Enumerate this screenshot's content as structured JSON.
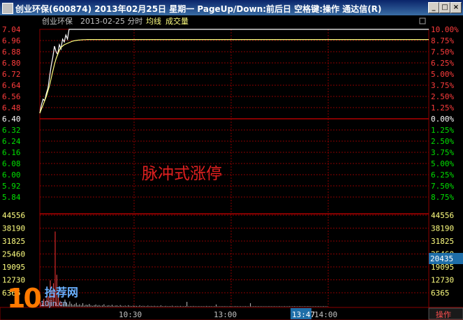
{
  "window": {
    "title": "创业环保(600874) 2013年02月25日 星期一 PageUp/Down:前后日 空格键:操作 通达信(R)",
    "buttons": [
      "_",
      "□",
      "×"
    ]
  },
  "chart_header": {
    "stock_name": "创业环保",
    "date_label": "2013-02-25 分时",
    "avg_line_label": "均线",
    "volume_label": "成交量"
  },
  "annotation": "脉冲式涨停",
  "volume_badge": "20435",
  "bottom_bar": {
    "time_labels": [
      "10:30",
      "13:00",
      "14:00"
    ],
    "cursor_time": "13:47",
    "action_label": "操作"
  },
  "watermark": {
    "number": "10",
    "name": "抬荐网",
    "url": "10jin.cn"
  },
  "colors": {
    "up": "#ff3c3c",
    "flat": "#ffffff",
    "down": "#00e000",
    "grid": "#8b0000",
    "price_line": "#ffffff",
    "avg_line": "#ffff80",
    "volume": "#ffff40"
  },
  "chart_data": [
    {
      "type": "line",
      "name": "price",
      "y_axis_left": [
        "7.04",
        "6.96",
        "6.88",
        "6.80",
        "6.72",
        "6.64",
        "6.56",
        "6.48",
        "6.40",
        "6.32",
        "6.24",
        "6.16",
        "6.08",
        "6.00",
        "5.92",
        "5.84"
      ],
      "y_axis_right": [
        "10.00%",
        "8.75%",
        "7.50%",
        "6.25%",
        "5.00%",
        "3.75%",
        "2.50%",
        "1.25%",
        "0.00%",
        "1.25%",
        "2.50%",
        "3.75%",
        "5.00%",
        "6.25%",
        "7.50%",
        "8.75%"
      ],
      "ylim": [
        5.84,
        7.04
      ],
      "series": [
        {
          "values": [
            6.44,
            6.5,
            6.54,
            6.53,
            6.58,
            6.62,
            6.7,
            6.78,
            6.84,
            6.92,
            6.88,
            6.86,
            6.93,
            6.9,
            6.97,
            6.95,
            7.0,
            6.97,
            7.04,
            7.04,
            7.04,
            7.04,
            7.04,
            7.04,
            7.04,
            7.04,
            7.04,
            7.04,
            7.04,
            7.04,
            7.04
          ]
        },
        {
          "values": [
            6.44,
            6.47,
            6.5,
            6.53,
            6.56,
            6.6,
            6.64,
            6.69,
            6.74,
            6.79,
            6.83,
            6.86,
            6.89,
            6.91,
            6.92,
            6.93,
            6.935,
            6.94,
            6.945,
            6.95,
            6.955,
            6.958,
            6.96,
            6.962,
            6.963,
            6.964,
            6.965,
            6.966,
            6.966,
            6.967,
            6.967
          ]
        }
      ]
    },
    {
      "type": "bar",
      "name": "volume",
      "y_axis_left": [
        "44556",
        "38190",
        "31825",
        "25460",
        "19095",
        "12730",
        "6365"
      ],
      "y_axis_right": [
        "44556",
        "38190",
        "31825",
        "25460",
        "19095",
        "12730",
        "6365"
      ],
      "ylim": [
        0,
        50921
      ],
      "values": [
        2500,
        1800,
        4200,
        3100,
        8000,
        5600,
        14000,
        9000,
        12500,
        40000,
        17000,
        6000,
        3200,
        2500,
        1500,
        3800,
        2200,
        1200,
        2800,
        1600,
        900,
        1400,
        2100,
        800,
        1300,
        700,
        1900,
        600,
        1100,
        900,
        1500,
        700,
        500,
        800,
        1200,
        600,
        900,
        500,
        700,
        1300,
        400,
        600,
        800,
        500,
        1000,
        450,
        600,
        700,
        380,
        900,
        500,
        400,
        650,
        300,
        800,
        450,
        350,
        600,
        500,
        400,
        300,
        700,
        350,
        500,
        420,
        300,
        600,
        280,
        450,
        350,
        500,
        300,
        400,
        250,
        700,
        350,
        300,
        450,
        280,
        380,
        300,
        550,
        260,
        350,
        400,
        300,
        450,
        250,
        320,
        380,
        2600,
        300,
        350,
        280,
        400,
        300,
        250,
        350,
        300,
        280,
        320,
        260,
        400,
        300,
        350,
        280,
        250,
        300,
        1200,
        280,
        260,
        300,
        350,
        280,
        300,
        250,
        280,
        320,
        260,
        300,
        280,
        350,
        250,
        300,
        260,
        280,
        300,
        250,
        270,
        1900,
        260,
        300,
        280,
        250,
        300,
        270,
        280,
        250,
        300,
        260,
        280,
        250,
        300,
        270,
        280,
        260,
        250,
        300,
        270,
        260,
        280,
        250,
        300,
        270,
        260,
        280,
        250,
        270,
        260,
        300,
        280,
        250,
        260,
        270,
        280,
        300,
        250,
        260,
        270,
        280,
        250,
        300,
        260,
        270,
        280,
        250,
        260
      ]
    }
  ]
}
